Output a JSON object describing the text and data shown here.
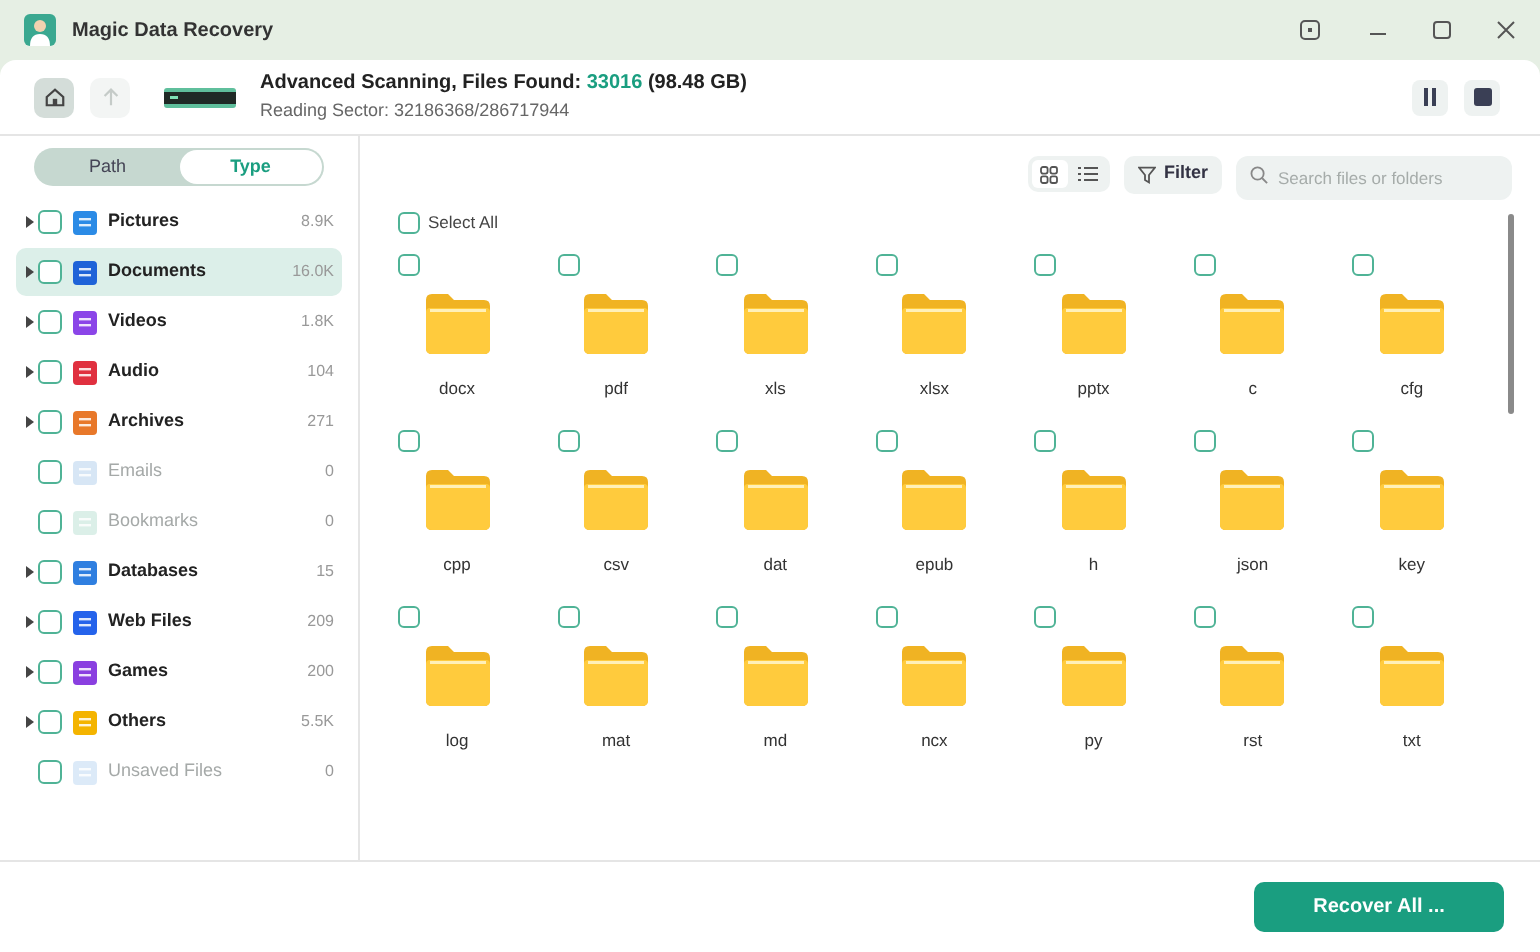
{
  "window": {
    "title": "Magic Data Recovery"
  },
  "header": {
    "status_label": "Advanced Scanning, Files Found:",
    "files_found": "33016",
    "size": "(98.48 GB)",
    "sector": "Reading Sector: 32186368/286717944",
    "home_selected": true,
    "up_disabled": true
  },
  "view_tabs": [
    {
      "label": "Path",
      "selected": false
    },
    {
      "label": "Type",
      "selected": true
    }
  ],
  "categories": [
    {
      "kind": "pictures",
      "label": "Pictures",
      "count": "8.9K",
      "expandable": true,
      "disabled": false,
      "selected": false,
      "checked": false
    },
    {
      "kind": "documents",
      "label": "Documents",
      "count": "16.0K",
      "expandable": true,
      "disabled": false,
      "selected": true,
      "checked": false
    },
    {
      "kind": "videos",
      "label": "Videos",
      "count": "1.8K",
      "expandable": true,
      "disabled": false,
      "selected": false,
      "checked": false
    },
    {
      "kind": "audio",
      "label": "Audio",
      "count": "104",
      "expandable": true,
      "disabled": false,
      "selected": false,
      "checked": false
    },
    {
      "kind": "archives",
      "label": "Archives",
      "count": "271",
      "expandable": true,
      "disabled": false,
      "selected": false,
      "checked": false
    },
    {
      "kind": "emails",
      "label": "Emails",
      "count": "0",
      "expandable": false,
      "disabled": true,
      "selected": false,
      "checked": false
    },
    {
      "kind": "bookmarks",
      "label": "Bookmarks",
      "count": "0",
      "expandable": false,
      "disabled": true,
      "selected": false,
      "checked": false
    },
    {
      "kind": "databases",
      "label": "Databases",
      "count": "15",
      "expandable": true,
      "disabled": false,
      "selected": false,
      "checked": false
    },
    {
      "kind": "web",
      "label": "Web Files",
      "count": "209",
      "expandable": true,
      "disabled": false,
      "selected": false,
      "checked": false
    },
    {
      "kind": "games",
      "label": "Games",
      "count": "200",
      "expandable": true,
      "disabled": false,
      "selected": false,
      "checked": false
    },
    {
      "kind": "others",
      "label": "Others",
      "count": "5.5K",
      "expandable": true,
      "disabled": false,
      "selected": false,
      "checked": false
    },
    {
      "kind": "unsaved",
      "label": "Unsaved Files",
      "count": "0",
      "expandable": false,
      "disabled": true,
      "selected": false,
      "checked": false
    }
  ],
  "toolbar": {
    "views": [
      {
        "kind": "grid",
        "selected": true
      },
      {
        "kind": "list",
        "selected": false
      }
    ],
    "filter": "Filter",
    "search_placeholder": "Search files or folders"
  },
  "select_all": {
    "label": "Select All",
    "checked": false
  },
  "folders": [
    {
      "name": "docx",
      "checked": false
    },
    {
      "name": "pdf",
      "checked": false
    },
    {
      "name": "xls",
      "checked": false
    },
    {
      "name": "xlsx",
      "checked": false
    },
    {
      "name": "pptx",
      "checked": false
    },
    {
      "name": "c",
      "checked": false
    },
    {
      "name": "cfg",
      "checked": false
    },
    {
      "name": "cpp",
      "checked": false
    },
    {
      "name": "csv",
      "checked": false
    },
    {
      "name": "dat",
      "checked": false
    },
    {
      "name": "epub",
      "checked": false
    },
    {
      "name": "h",
      "checked": false
    },
    {
      "name": "json",
      "checked": false
    },
    {
      "name": "key",
      "checked": false
    },
    {
      "name": "log",
      "checked": false
    },
    {
      "name": "mat",
      "checked": false
    },
    {
      "name": "md",
      "checked": false
    },
    {
      "name": "ncx",
      "checked": false
    },
    {
      "name": "py",
      "checked": false
    },
    {
      "name": "rst",
      "checked": false
    },
    {
      "name": "txt",
      "checked": false
    }
  ],
  "recover_button": "Recover All ..."
}
